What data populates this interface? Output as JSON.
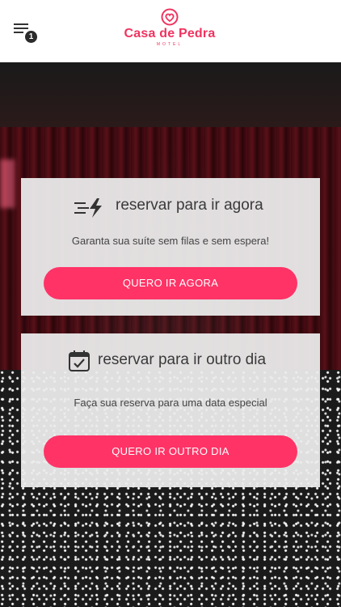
{
  "header": {
    "menu_badge": "1",
    "brand_name": "Casa de Pedra",
    "brand_sub": "MOTEL",
    "brand_color": "#f0335f"
  },
  "cards": [
    {
      "icon": "fast-lightning-icon",
      "title": "reservar para ir agora",
      "subtitle": "Garanta sua suíte sem filas e sem espera!",
      "button": "QUERO IR AGORA"
    },
    {
      "icon": "calendar-check-icon",
      "title": "reservar para ir outro dia",
      "subtitle": "Faça sua reserva para uma data especial",
      "button": "QUERO IR OUTRO DIA"
    }
  ],
  "colors": {
    "accent": "#ff3366",
    "card_bg": "#ececec",
    "text": "#3a3a3a"
  }
}
